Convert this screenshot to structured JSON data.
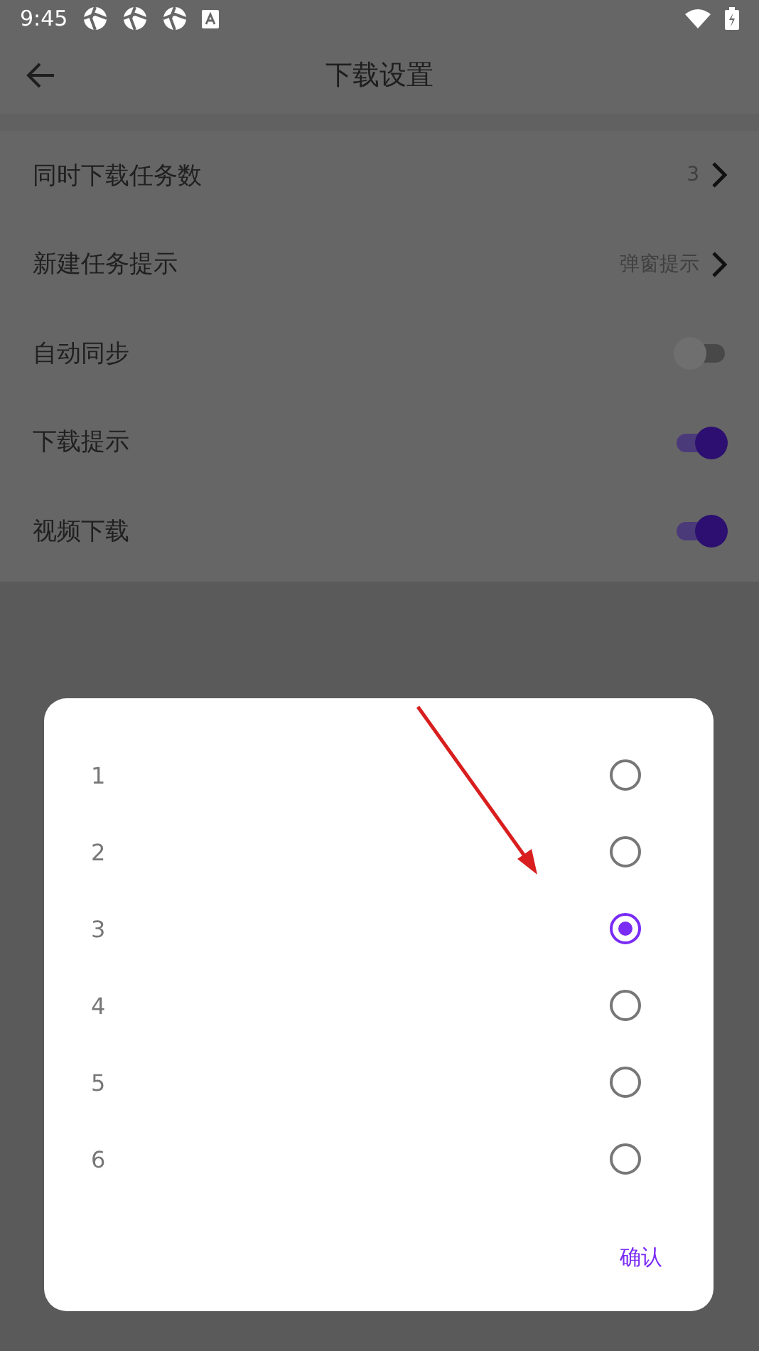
{
  "status_bar": {
    "time": "9:45"
  },
  "app_bar": {
    "title": "下载设置"
  },
  "settings": [
    {
      "kind": "value",
      "label": "同时下载任务数",
      "value": "3"
    },
    {
      "kind": "value",
      "label": "新建任务提示",
      "value": "弹窗提示"
    },
    {
      "kind": "switch",
      "label": "自动同步",
      "on": false
    },
    {
      "kind": "switch",
      "label": "下载提示",
      "on": true
    },
    {
      "kind": "switch",
      "label": "视频下载",
      "on": true
    }
  ],
  "dialog": {
    "options": [
      {
        "label": "1",
        "selected": false
      },
      {
        "label": "2",
        "selected": false
      },
      {
        "label": "3",
        "selected": true
      },
      {
        "label": "4",
        "selected": false
      },
      {
        "label": "5",
        "selected": false
      },
      {
        "label": "6",
        "selected": false
      }
    ],
    "confirm": "确认"
  }
}
